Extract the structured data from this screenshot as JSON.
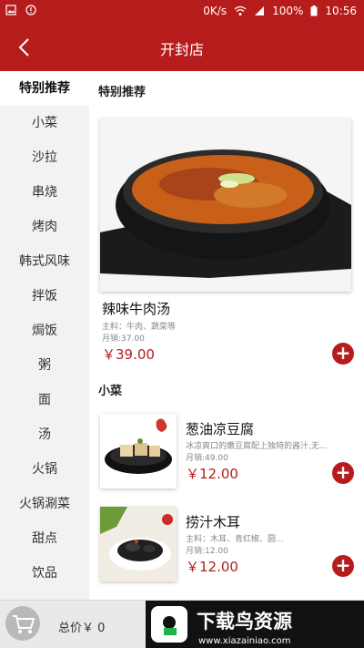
{
  "status_bar": {
    "network_speed": "0K/s",
    "battery": "100%",
    "time": "10:56"
  },
  "header": {
    "title": "开封店"
  },
  "sidebar": {
    "items": [
      {
        "label": "特别推荐"
      },
      {
        "label": "小菜"
      },
      {
        "label": "沙拉"
      },
      {
        "label": "串烧"
      },
      {
        "label": "烤肉"
      },
      {
        "label": "韩式风味"
      },
      {
        "label": "拌饭"
      },
      {
        "label": "焗饭"
      },
      {
        "label": "粥"
      },
      {
        "label": "面"
      },
      {
        "label": "汤"
      },
      {
        "label": "火锅"
      },
      {
        "label": "火锅涮菜"
      },
      {
        "label": "甜点"
      },
      {
        "label": "饮品"
      }
    ]
  },
  "sections": {
    "featured": {
      "title": "特别推荐",
      "item": {
        "name": "辣味牛肉汤",
        "ingredients": "主料：牛肉、蔬菜等",
        "sales": "月销:37.00",
        "price": "￥39.00"
      }
    },
    "side_dishes": {
      "title": "小菜",
      "items": [
        {
          "name": "葱油凉豆腐",
          "desc": "冰凉爽口的嫩豆腐配上独特的酱汁,无...",
          "sales": "月销:49.00",
          "price": "￥12.00"
        },
        {
          "name": "捞汁木耳",
          "desc": "主料：木耳、青红椒、圆...",
          "sales": "月销:12.00",
          "price": "￥12.00"
        }
      ]
    }
  },
  "bottom_bar": {
    "total_label": "总价￥ 0",
    "brand_text": "下载鸟资源",
    "brand_url": "www.xiazainiao.com"
  },
  "colors": {
    "primary": "#b71c1c",
    "sidebar_bg": "#f2f2f2"
  }
}
